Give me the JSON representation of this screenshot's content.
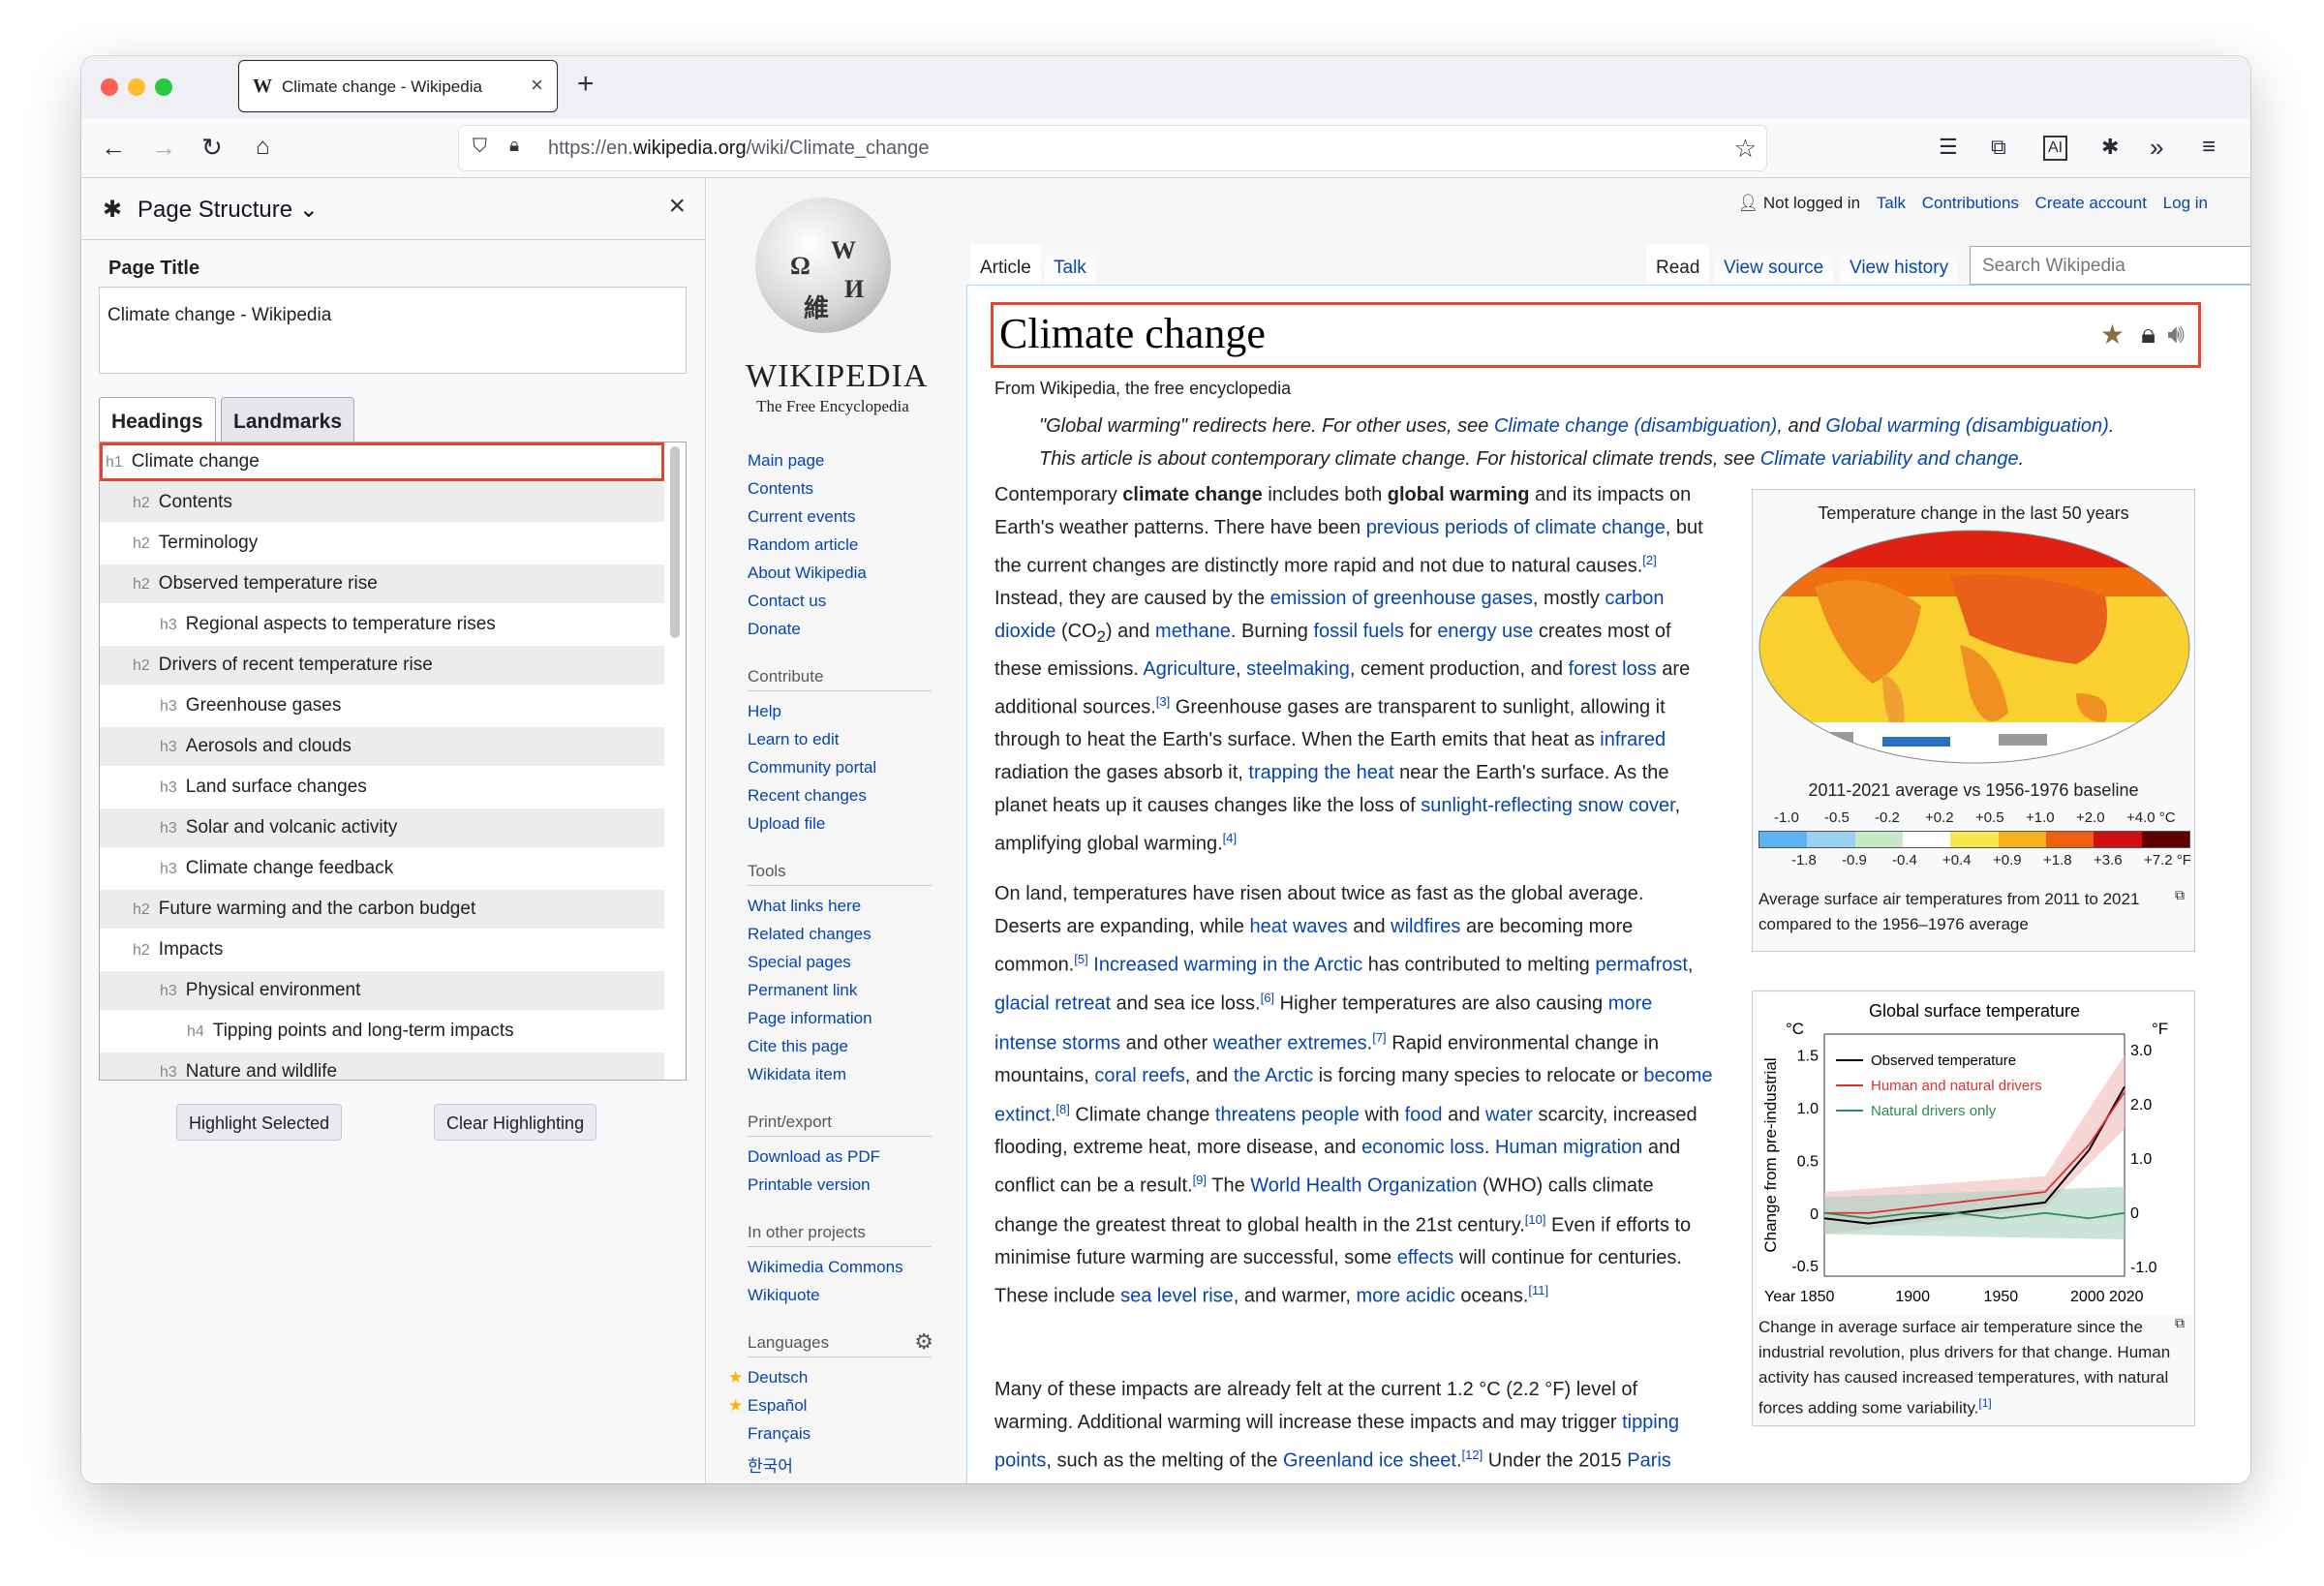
{
  "browser": {
    "tab_title": "Climate change - Wikipedia",
    "url_prefix": "https://en.",
    "url_host": "wikipedia.org",
    "url_path": "/wiki/Climate_change"
  },
  "sidebar": {
    "title": "Page Structure",
    "page_title_label": "Page Title",
    "page_title_value": "Climate change - Wikipedia",
    "tabs": [
      "Headings",
      "Landmarks"
    ],
    "headings": [
      {
        "level": "h1",
        "text": "Climate change"
      },
      {
        "level": "h2",
        "text": "Contents"
      },
      {
        "level": "h2",
        "text": "Terminology"
      },
      {
        "level": "h2",
        "text": "Observed temperature rise"
      },
      {
        "level": "h3",
        "text": "Regional aspects to temperature rises"
      },
      {
        "level": "h2",
        "text": "Drivers of recent temperature rise"
      },
      {
        "level": "h3",
        "text": "Greenhouse gases"
      },
      {
        "level": "h3",
        "text": "Aerosols and clouds"
      },
      {
        "level": "h3",
        "text": "Land surface changes"
      },
      {
        "level": "h3",
        "text": "Solar and volcanic activity"
      },
      {
        "level": "h3",
        "text": "Climate change feedback"
      },
      {
        "level": "h2",
        "text": "Future warming and the carbon budget"
      },
      {
        "level": "h2",
        "text": "Impacts"
      },
      {
        "level": "h3",
        "text": "Physical environment"
      },
      {
        "level": "h4",
        "text": "Tipping points and long-term impacts"
      },
      {
        "level": "h3",
        "text": "Nature and wildlife"
      }
    ],
    "highlight_btn": "Highlight Selected",
    "clear_btn": "Clear Highlighting"
  },
  "wiki": {
    "wordmark": "WIKIPEDIA",
    "tagline": "The Free Encyclopedia",
    "nav": [
      "Main page",
      "Contents",
      "Current events",
      "Random article",
      "About Wikipedia",
      "Contact us",
      "Donate"
    ],
    "contribute_title": "Contribute",
    "contribute": [
      "Help",
      "Learn to edit",
      "Community portal",
      "Recent changes",
      "Upload file"
    ],
    "tools_title": "Tools",
    "tools": [
      "What links here",
      "Related changes",
      "Special pages",
      "Permanent link",
      "Page information",
      "Cite this page",
      "Wikidata item"
    ],
    "print_title": "Print/export",
    "print": [
      "Download as PDF",
      "Printable version"
    ],
    "projects_title": "In other projects",
    "projects": [
      "Wikimedia Commons",
      "Wikiquote"
    ],
    "languages_title": "Languages",
    "languages": [
      "Deutsch",
      "Español",
      "Français",
      "한국어"
    ],
    "user": {
      "not_logged": "Not logged in",
      "talk": "Talk",
      "contrib": "Contributions",
      "create": "Create account",
      "login": "Log in"
    },
    "tabs": {
      "article": "Article",
      "talk": "Talk",
      "read": "Read",
      "source": "View source",
      "history": "View history"
    },
    "search_placeholder": "Search Wikipedia",
    "title": "Climate change",
    "from": "From Wikipedia, the free encyclopedia",
    "fig1": {
      "title": "Temperature change in the last 50 years",
      "subtitle": "2011-2021 average vs 1956-1976 baseline",
      "scale_c": [
        "-1.0",
        "-0.5",
        "-0.2",
        "+0.2",
        "+0.5",
        "+1.0",
        "+2.0",
        "+4.0 °C"
      ],
      "scale_f": [
        "-1.8",
        "-0.9",
        "-0.4",
        "+0.4",
        "+0.9",
        "+1.8",
        "+3.6",
        "+7.2 °F"
      ],
      "caption": "Average surface air temperatures from 2011 to 2021 compared to the 1956–1976 average"
    },
    "fig2": {
      "title": "Global surface temperature",
      "unit_c": "°C",
      "unit_f": "°F",
      "ylabel": "Change from pre-industrial",
      "legend": [
        "Observed temperature",
        "Human and natural drivers",
        "Natural drivers only"
      ],
      "yticks_c": [
        "1.5",
        "1.0",
        "0.5",
        "0",
        "-0.5"
      ],
      "yticks_f": [
        "3.0",
        "2.0",
        "1.0",
        "0",
        "-1.0"
      ],
      "xticks": [
        "Year 1850",
        "1900",
        "1950",
        "2000 2020"
      ],
      "caption": "Change in average surface air temperature since the industrial revolution, plus drivers for that change. Human activity has caused increased temperatures, with natural forces adding some variability.",
      "cap_ref": "[1]"
    }
  },
  "chart_data": {
    "type": "line",
    "title": "Global surface temperature",
    "ylabel": "Change from pre-industrial",
    "x": [
      1850,
      1875,
      1900,
      1925,
      1950,
      1975,
      2000,
      2020
    ],
    "xlim": [
      1850,
      2020
    ],
    "ylim": [
      -0.6,
      1.7
    ],
    "series": [
      {
        "name": "Observed temperature",
        "color": "#000000",
        "values": [
          -0.05,
          -0.1,
          -0.05,
          0.0,
          0.05,
          0.1,
          0.6,
          1.2
        ]
      },
      {
        "name": "Human and natural drivers",
        "color": "#e03030",
        "values": [
          0.0,
          0.0,
          0.05,
          0.1,
          0.15,
          0.2,
          0.65,
          1.15
        ]
      },
      {
        "name": "Natural drivers only",
        "color": "#2e8b57",
        "values": [
          0.0,
          -0.05,
          0.0,
          0.0,
          -0.05,
          0.0,
          -0.05,
          0.0
        ]
      }
    ]
  }
}
